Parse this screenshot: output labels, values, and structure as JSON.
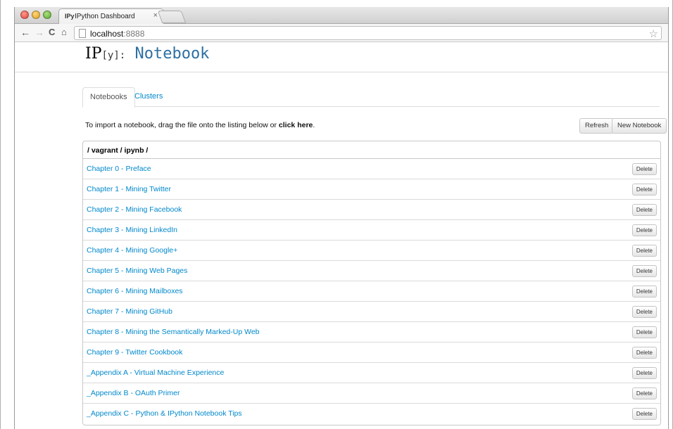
{
  "browser": {
    "tab_favicon": "IPy",
    "tab_title": "IPython Dashboard",
    "tab_close": "×",
    "url_host": "localhost",
    "url_port": ":8888",
    "icons": [
      "back-arrow-icon",
      "forward-arrow-icon",
      "reload-icon",
      "home-icon",
      "page-icon",
      "star-icon"
    ]
  },
  "header": {
    "logo_ip": "IP",
    "logo_y": "[y]:",
    "logo_notebook": "Notebook"
  },
  "tabs": [
    {
      "label": "Notebooks",
      "active": true
    },
    {
      "label": "Clusters",
      "active": false
    }
  ],
  "import": {
    "text": "To import a notebook, drag the file onto the listing below or ",
    "link": "click here",
    "end": "."
  },
  "buttons": {
    "refresh": "Refresh",
    "new_notebook": "New Notebook"
  },
  "listing": {
    "path": "/ vagrant / ipynb /",
    "delete_label": "Delete",
    "items": [
      {
        "name": "Chapter 0 - Preface",
        "delete": "Delete"
      },
      {
        "name": "Chapter 1 - Mining Twitter",
        "delete": "Delete"
      },
      {
        "name": "Chapter 2 - Mining Facebook",
        "delete": "Delete"
      },
      {
        "name": "Chapter 3 - Mining LinkedIn",
        "delete": "Delete"
      },
      {
        "name": "Chapter 4 - Mining Google+",
        "delete": "Delete"
      },
      {
        "name": "Chapter 5 - Mining Web Pages",
        "delete": "Delete"
      },
      {
        "name": "Chapter 6 - Mining Mailboxes",
        "delete": "Delete"
      },
      {
        "name": "Chapter 7 - Mining GitHub",
        "delete": "Delete"
      },
      {
        "name": "Chapter 8 - Mining the Semantically Marked-Up Web",
        "delete": "Delete"
      },
      {
        "name": "Chapter 9 - Twitter Cookbook",
        "delete": "Delete"
      },
      {
        "name": "_Appendix A - Virtual Machine Experience",
        "delete": "Delete"
      },
      {
        "name": "_Appendix B - OAuth Primer",
        "delete": "Delete"
      },
      {
        "name": "_Appendix C - Python & IPython Notebook Tips",
        "delete": "Delete"
      }
    ]
  },
  "colors": {
    "link": "#0088cc",
    "logo_notebook": "#2e6fa1"
  }
}
